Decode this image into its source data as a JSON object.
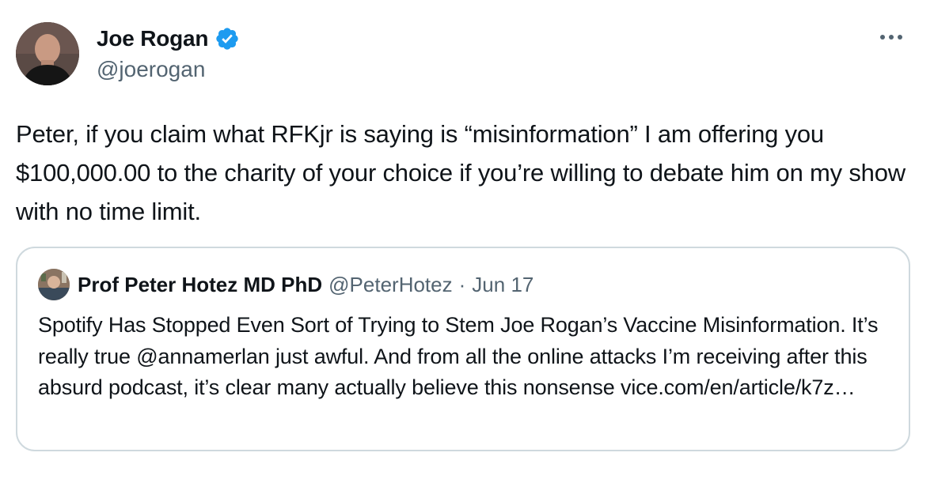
{
  "author": {
    "display_name": "Joe Rogan",
    "handle": "@joerogan",
    "verified": true
  },
  "tweet": {
    "text": "Peter, if you claim what RFKjr is saying is “misinformation” I am offering you $100,000.00 to the charity of your choice if you’re willing to debate him on my show with no time limit."
  },
  "quoted_tweet": {
    "display_name": "Prof Peter Hotez MD PhD",
    "handle": "@PeterHotez",
    "separator": "·",
    "date": "Jun 17",
    "text": "Spotify Has Stopped Even Sort of Trying to Stem Joe Rogan’s Vaccine Misinformation. It’s really true @annamerlan just awful. And from all the online attacks I’m receiving after this absurd podcast, it’s clear many actually believe this nonsense vice.com/en/article/k7z…"
  },
  "colors": {
    "text_primary": "#0f1419",
    "text_secondary": "#536471",
    "verified_badge": "#1d9bf0",
    "quote_border": "#cfd9de"
  },
  "icons": {
    "verified": "verified-badge-icon",
    "more": "more-options-icon"
  }
}
